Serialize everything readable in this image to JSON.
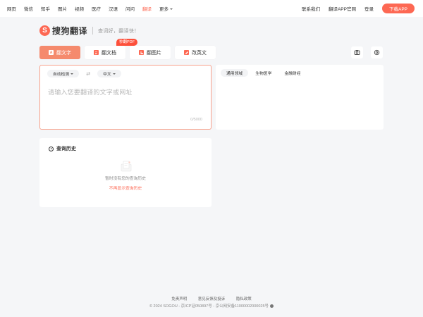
{
  "topnav": {
    "items": [
      "网页",
      "微信",
      "知乎",
      "图片",
      "视频",
      "医疗",
      "汉语",
      "问问",
      "翻译",
      "更多"
    ],
    "active_index": 8,
    "right_links": [
      "联系我们",
      "翻译APP官网",
      "登录"
    ],
    "download_label": "下载APP"
  },
  "brand": {
    "logo_letter": "S",
    "name": "搜狗翻译",
    "slogan": "查词好，翻译快！"
  },
  "tabs": [
    {
      "label": "翻文字",
      "icon_char": "A",
      "icon": "text-icon",
      "active": true
    },
    {
      "label": "翻文档",
      "icon_char": "",
      "icon": "document-icon",
      "active": false,
      "badge": "秒翻PDF"
    },
    {
      "label": "翻图片",
      "icon_char": "",
      "icon": "image-icon",
      "active": false
    },
    {
      "label": "改英文",
      "icon_char": "",
      "icon": "edit-icon",
      "active": false
    }
  ],
  "toolbar": {
    "left_icon": "screenshot-icon",
    "right_icon": "settings-icon"
  },
  "source": {
    "from_lang": "自动检测",
    "to_lang": "中文",
    "placeholder": "请输入您要翻译的文字或网址",
    "counter": "0/5000"
  },
  "target": {
    "domains": [
      "通用领域",
      "生物医学",
      "金融财经"
    ],
    "active_index": 0
  },
  "history": {
    "title": "查询历史",
    "empty_text": "暂时没有您的查询历史",
    "link_text": "不再显示查询历史"
  },
  "footer": {
    "links": [
      "免责声明",
      "意见反馈及投诉",
      "隐私政策"
    ],
    "copyright": "© 2024 SOGOU - 京ICP证050897号 - 京公网安备11000002000025号"
  },
  "colors": {
    "accent": "#fd6853",
    "tab_active": "#f58a6d",
    "background": "#f5f6f8"
  }
}
